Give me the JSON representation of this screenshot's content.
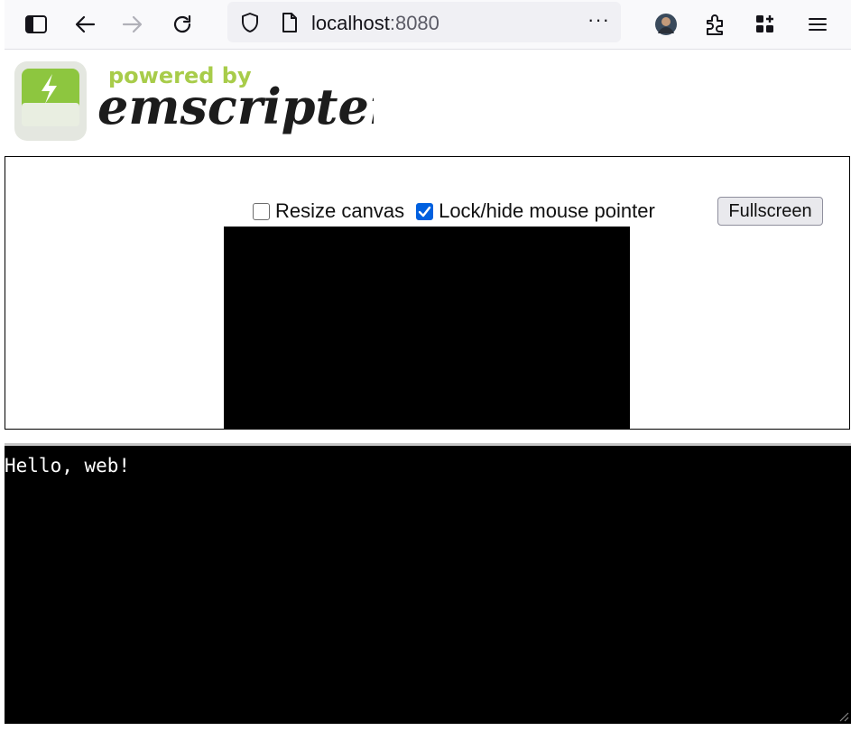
{
  "browser": {
    "url_host": "localhost",
    "url_port": ":8080",
    "more_label": "···"
  },
  "logo": {
    "tagline": "powered by",
    "wordmark": "emscripten"
  },
  "controls": {
    "resize_label": "Resize canvas",
    "resize_checked": false,
    "lock_label": "Lock/hide mouse pointer",
    "lock_checked": true,
    "fullscreen_label": "Fullscreen"
  },
  "output": {
    "text": "Hello, web!"
  },
  "colors": {
    "accent": "#0060df",
    "logo_green": "#8dc63f",
    "canvas_bg": "#000000",
    "output_bg": "#000000"
  },
  "icons": [
    "sidebar-icon",
    "back-arrow-icon",
    "forward-arrow-icon",
    "reload-icon",
    "shield-icon",
    "page-icon",
    "avatar",
    "extensions-icon",
    "apps-icon",
    "menu-icon"
  ]
}
